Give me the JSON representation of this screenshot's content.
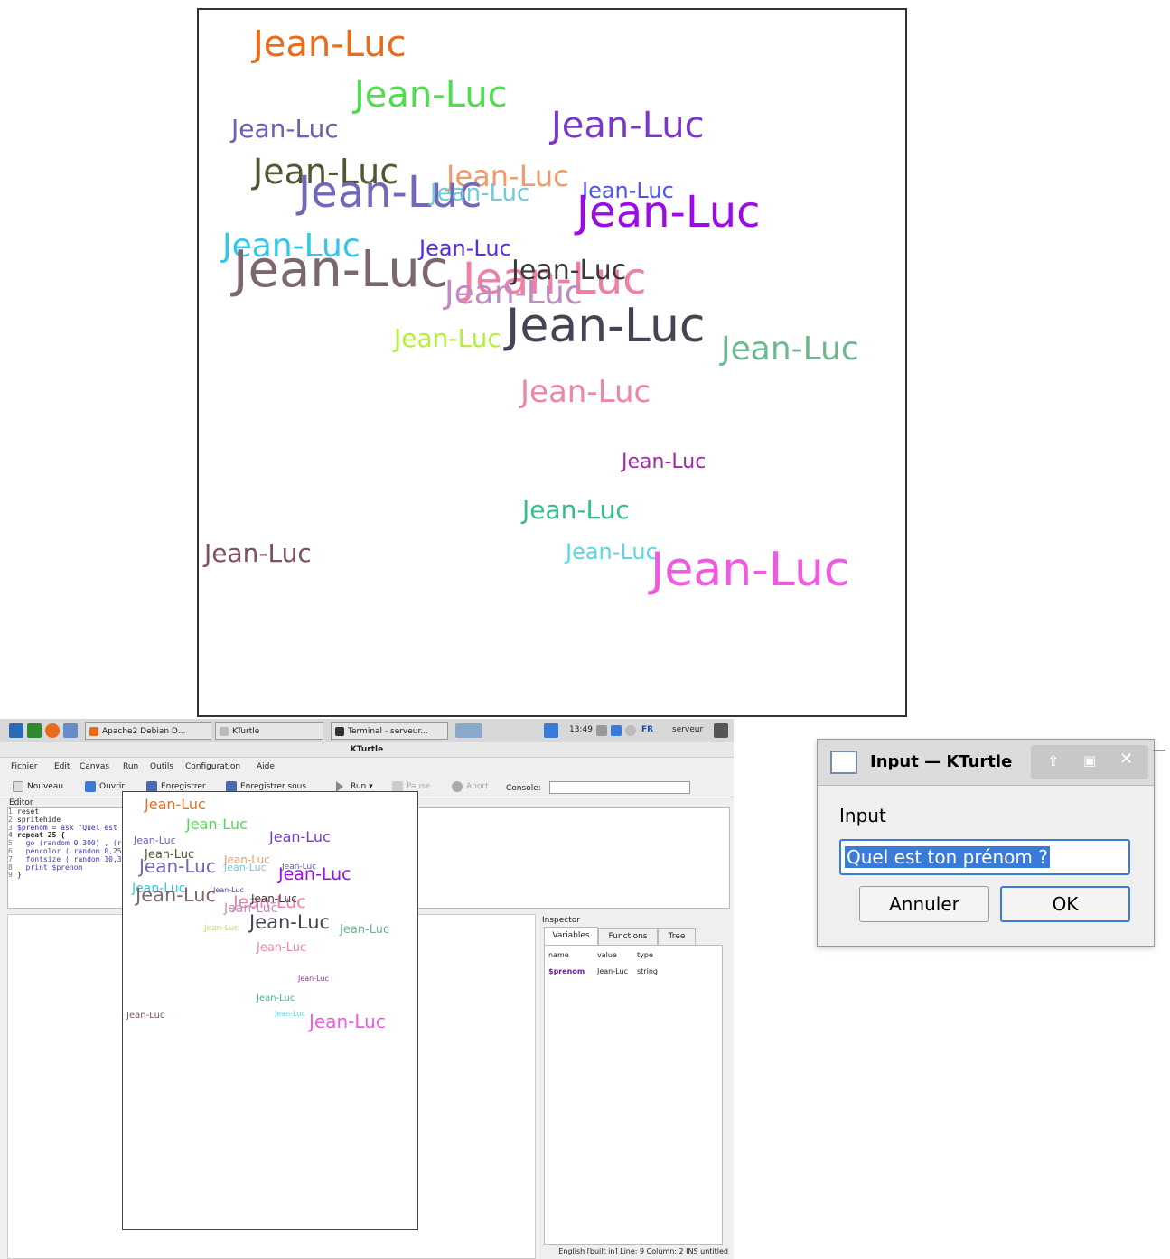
{
  "canvas_text": "Jean-Luc",
  "big_words": [
    {
      "color": "#ea6b1a"
    },
    {
      "color": "#4fdc4f"
    },
    {
      "color": "#6a60b8"
    },
    {
      "color": "#7a38c8"
    },
    {
      "color": "#555533"
    },
    {
      "color": "#ef9a6a"
    },
    {
      "color": "#7069bb"
    },
    {
      "color": "#74c9d6"
    },
    {
      "color": "#4b55e6"
    },
    {
      "color": "#9a0be6"
    },
    {
      "color": "#2fc8ea"
    },
    {
      "color": "#5a2be0"
    },
    {
      "color": "#7c6670"
    },
    {
      "color": "#ef7fa8"
    },
    {
      "color": "#3a3a3a"
    },
    {
      "color": "#c08cc0"
    },
    {
      "color": "#b6ef3a"
    },
    {
      "color": "#444455"
    },
    {
      "color": "#6db88e"
    },
    {
      "color": "#ef86a6"
    },
    {
      "color": "#a02aa8"
    },
    {
      "color": "#34bf88"
    },
    {
      "color": "#805060"
    },
    {
      "color": "#5ad6e0"
    },
    {
      "color": "#ef5ae0"
    }
  ],
  "taskbar": {
    "tasks": [
      "Apache2 Debian D...",
      "KTurtle",
      "Terminal - serveur..."
    ],
    "time": "13:49",
    "lang": "FR",
    "user": "serveur"
  },
  "window_title": "KTurtle",
  "menu": [
    "Fichier",
    "Edit",
    "Canvas",
    "Run",
    "Outils",
    "Configuration",
    "Aide"
  ],
  "toolbar": {
    "new": "Nouveau",
    "open": "Ouvrir",
    "save": "Enregistrer",
    "save_as": "Enregistrer sous",
    "run": "Run",
    "pause": "Pause",
    "abort": "Abort",
    "console": "Console:"
  },
  "editor": {
    "label": "Editor",
    "lines": [
      "reset",
      "spritehide",
      "$prenom = ask \"Quel est ton prénom ?\"",
      "repeat 25 {",
      "  go (random 0,300) , (random 0, 300)",
      "  pencolor ( random 0,250), ( random 0,250),( random 0,250)",
      "  fontsize ( random 10,30)",
      "  print $prenom",
      "}"
    ]
  },
  "inspector": {
    "title": "Inspector",
    "tabs": [
      "Variables",
      "Functions",
      "Tree"
    ],
    "columns": [
      "name",
      "value",
      "type"
    ],
    "rows": [
      {
        "name": "$prenom",
        "value": "Jean-Luc",
        "type": "string"
      }
    ]
  },
  "status": "English [built in]   Line: 9 Column: 2   INS   untitled",
  "dialog": {
    "title": "Input — KTurtle",
    "label": "Input",
    "value": "Quel est ton prénom ?",
    "cancel": "Annuler",
    "ok": "OK"
  }
}
